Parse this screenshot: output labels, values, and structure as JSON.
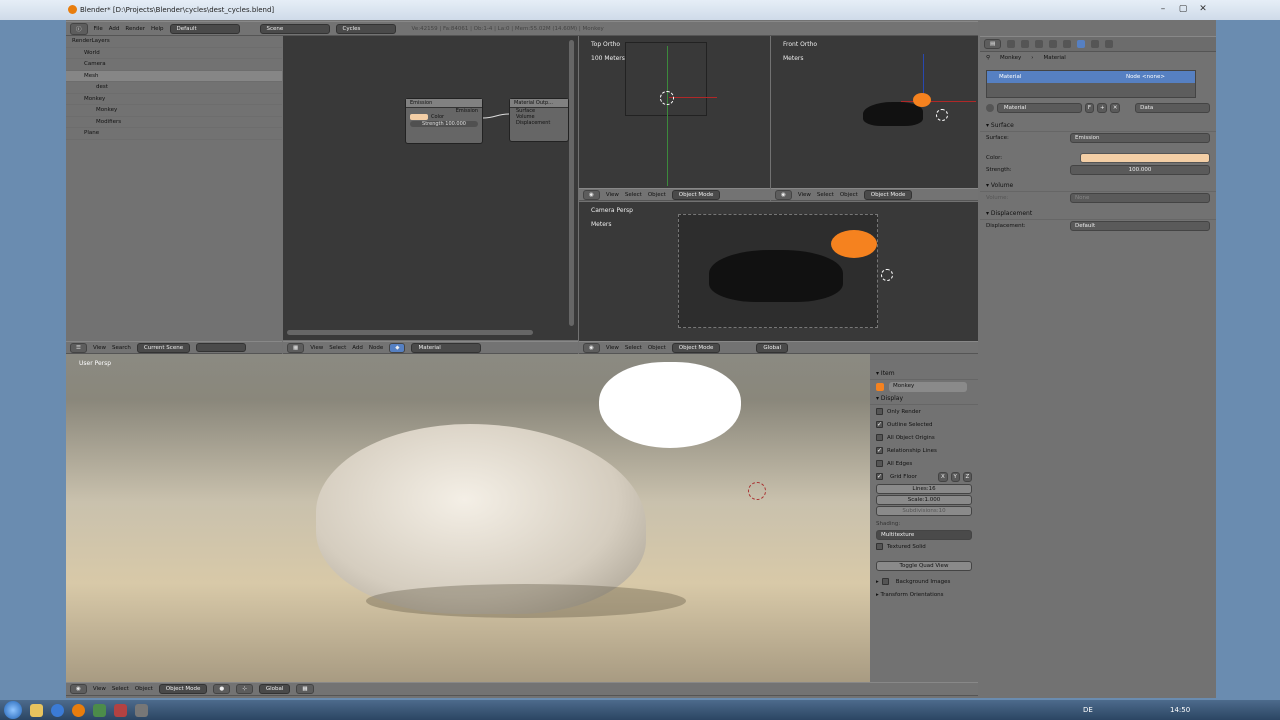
{
  "window": {
    "title": "Blender* [D:\\Projects\\Blender\\cycles\\dest_cycles.blend]"
  },
  "info_header": {
    "menus": [
      "File",
      "Add",
      "Render",
      "Help"
    ],
    "layout": "Default",
    "scene": "Scene",
    "engine": "Cycles",
    "stats": "Ve:42159 | Fa:84061 | Ob:1-4 | La:0 | Mem:55.02M (14.60M) | Monkey"
  },
  "outliner": {
    "rows": [
      "RenderLayers",
      "World",
      "Camera",
      "Mesh",
      "dest",
      "Monkey",
      "Monkey",
      "Modifiers",
      "Plane"
    ],
    "header": {
      "view": "View",
      "search": "Search",
      "scope": "Current Scene"
    }
  },
  "node_editor": {
    "emission_node": {
      "title": "Emission",
      "output": "Emission",
      "color_label": "Color",
      "strength": "Strength 100.000"
    },
    "output_node": {
      "title": "Material Outp...",
      "inputs": [
        "Surface",
        "Volume",
        "Displacement"
      ]
    },
    "header": {
      "menus": [
        "View",
        "Select",
        "Add",
        "Node"
      ],
      "material": "Material"
    }
  },
  "viewports": {
    "top": {
      "label": "Top Ortho",
      "units": "100 Meters"
    },
    "front": {
      "label": "Front Ortho",
      "units": "Meters"
    },
    "camera": {
      "label": "Camera Persp",
      "units": "Meters"
    },
    "user": {
      "label": "User Persp"
    },
    "header_menus": [
      "View",
      "Select",
      "Object"
    ],
    "mode": "Object Mode",
    "orientation": "Global"
  },
  "properties": {
    "breadcrumb": [
      "Monkey",
      "Material"
    ],
    "slot_row": {
      "material": "Material",
      "node": "Node <none>"
    },
    "datablock": "Material",
    "datablock_users": "F",
    "link": "Data",
    "surface_section": "Surface",
    "surface_label": "Surface:",
    "surface_value": "Emission",
    "color_label": "Color:",
    "strength_label": "Strength:",
    "strength_value": "100.000",
    "volume_section": "Volume",
    "volume_label": "Volume:",
    "volume_value": "None",
    "displacement_section": "Displacement",
    "displacement_label": "Displacement:",
    "displacement_value": "Default"
  },
  "npanel": {
    "item_section": "Item",
    "object_name": "Monkey",
    "display_section": "Display",
    "options": [
      {
        "label": "Only Render",
        "checked": false
      },
      {
        "label": "Outline Selected",
        "checked": true
      },
      {
        "label": "All Object Origins",
        "checked": false
      },
      {
        "label": "Relationship Lines",
        "checked": true
      },
      {
        "label": "All Edges",
        "checked": false
      }
    ],
    "grid_floor": "Grid Floor",
    "axes": [
      "X",
      "Y",
      "Z"
    ],
    "lines": "Lines:16",
    "scale": "Scale:1.000",
    "subdivisions": "Subdivisions:10",
    "shading_label": "Shading:",
    "shading_value": "Multitexture",
    "textured_solid": "Textured Solid",
    "toggle_quad": "Toggle Quad View",
    "background_images": "Background Images",
    "transform_orientations": "Transform Orientations"
  },
  "taskbar": {
    "lang": "DE",
    "time": "14:50"
  },
  "colors": {
    "selection_blue": "#5680c2",
    "emission_color": "#f4cfa6",
    "object_orange": "#f5821f"
  }
}
